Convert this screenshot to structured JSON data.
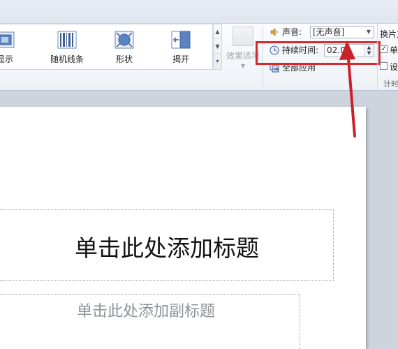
{
  "ribbon": {
    "gallery": {
      "items": [
        {
          "label": "显示",
          "icon": "show-transition-icon"
        },
        {
          "label": "随机线条",
          "icon": "random-bars-icon"
        },
        {
          "label": "形状",
          "icon": "shape-icon"
        },
        {
          "label": "揭开",
          "icon": "uncover-icon"
        }
      ]
    },
    "effect_options": {
      "label": "效果选项"
    },
    "timing": {
      "sound_label": "声音:",
      "sound_value": "[无声音]",
      "duration_label": "持续时间:",
      "duration_value": "02.00",
      "apply_all_label": "全部应用",
      "group_label": "计时"
    },
    "advance": {
      "title": "换片方",
      "on_click_label": "单",
      "on_click_checked": true,
      "after_label": "设",
      "after_checked": false
    }
  },
  "slide": {
    "title_placeholder": "单击此处添加标题",
    "subtitle_placeholder": "单击此处添加副标题"
  },
  "colors": {
    "highlight": "#d8292f",
    "arrow": "#c8232a"
  }
}
